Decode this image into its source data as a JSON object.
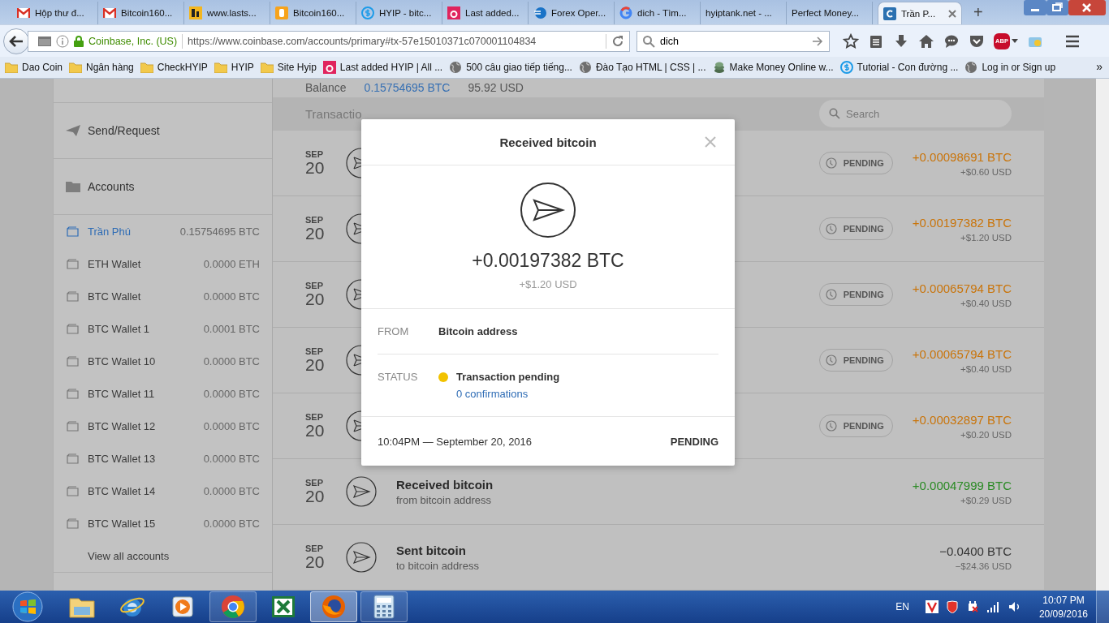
{
  "browser": {
    "tabs": [
      {
        "title": "Hộp thư đ...",
        "kind": "mail",
        "selected": false
      },
      {
        "title": "Bitcoin160...",
        "kind": "mail",
        "selected": false
      },
      {
        "title": "www.lasts...",
        "kind": "pi",
        "selected": false
      },
      {
        "title": "Bitcoin160...",
        "kind": "b",
        "selected": false
      },
      {
        "title": "HYIP - bitc...",
        "kind": "dollar",
        "selected": false
      },
      {
        "title": "Last added...",
        "kind": "a",
        "selected": false
      },
      {
        "title": "Forex Oper...",
        "kind": "forex",
        "selected": false
      },
      {
        "title": "dich - Tìm...",
        "kind": "g",
        "selected": false
      },
      {
        "title": "hyiptank.net - ...",
        "kind": "none",
        "selected": false
      },
      {
        "title": "Perfect Money...",
        "kind": "none",
        "selected": false
      },
      {
        "title": "Trần P...",
        "kind": "c",
        "selected": true
      }
    ],
    "new_tab": "+",
    "site_identity": "Coinbase, Inc. (US)",
    "url": "https://www.coinbase.com/accounts/primary#tx-57e15010371c070001104834",
    "search": {
      "value": "dich"
    },
    "abp_label": "ABP",
    "bookmarks": [
      {
        "label": "Dao Coin",
        "kind": "folder"
      },
      {
        "label": "Ngân hàng",
        "kind": "folder"
      },
      {
        "label": "CheckHYIP",
        "kind": "folder"
      },
      {
        "label": "HYIP",
        "kind": "folder"
      },
      {
        "label": "Site Hyip",
        "kind": "folder"
      },
      {
        "label": "Last added HYIP | All ...",
        "kind": "a"
      },
      {
        "label": "500 câu giao tiếp tiếng...",
        "kind": "globe"
      },
      {
        "label": "Đào Tạo HTML | CSS | ...",
        "kind": "globe"
      },
      {
        "label": "Make Money Online w...",
        "kind": "coin"
      },
      {
        "label": "Tutorial - Con đường ...",
        "kind": "dollar"
      },
      {
        "label": "Log in or Sign up",
        "kind": "globe"
      }
    ],
    "bookmarks_more": "»"
  },
  "sidebar": {
    "nav": [
      {
        "label": "Send/Request",
        "kind": "plane"
      },
      {
        "label": "Accounts",
        "kind": "folder"
      }
    ],
    "accounts": [
      {
        "name": "Trần Phú",
        "balance": "0.15754695 BTC",
        "selected": true
      },
      {
        "name": "ETH Wallet",
        "balance": "0.0000 ETH",
        "selected": false
      },
      {
        "name": "BTC Wallet",
        "balance": "0.0000 BTC",
        "selected": false
      },
      {
        "name": "BTC Wallet 1",
        "balance": "0.0001 BTC",
        "selected": false
      },
      {
        "name": "BTC Wallet 10",
        "balance": "0.0000 BTC",
        "selected": false
      },
      {
        "name": "BTC Wallet 11",
        "balance": "0.0000 BTC",
        "selected": false
      },
      {
        "name": "BTC Wallet 12",
        "balance": "0.0000 BTC",
        "selected": false
      },
      {
        "name": "BTC Wallet 13",
        "balance": "0.0000 BTC",
        "selected": false
      },
      {
        "name": "BTC Wallet 14",
        "balance": "0.0000 BTC",
        "selected": false
      },
      {
        "name": "BTC Wallet 15",
        "balance": "0.0000 BTC",
        "selected": false
      }
    ],
    "view_all": "View all accounts"
  },
  "balance": {
    "label": "Balance",
    "btc": "0.15754695 BTC",
    "usd": "95.92 USD"
  },
  "transactions": {
    "heading": "Transactio",
    "search": {
      "placeholder": "Search"
    },
    "rows": [
      {
        "kind": "pending",
        "month": "SEP",
        "day": "20",
        "status": "PENDING",
        "amount": "+0.00098691 BTC",
        "usd": "+$0.60 USD"
      },
      {
        "kind": "pending",
        "month": "SEP",
        "day": "20",
        "status": "PENDING",
        "amount": "+0.00197382 BTC",
        "usd": "+$1.20 USD"
      },
      {
        "kind": "pending",
        "month": "SEP",
        "day": "20",
        "status": "PENDING",
        "amount": "+0.00065794 BTC",
        "usd": "+$0.40 USD"
      },
      {
        "kind": "pending",
        "month": "SEP",
        "day": "20",
        "status": "PENDING",
        "amount": "+0.00065794 BTC",
        "usd": "+$0.40 USD"
      },
      {
        "kind": "pending",
        "month": "SEP",
        "day": "20",
        "status": "PENDING",
        "amount": "+0.00032897 BTC",
        "usd": "+$0.20 USD"
      },
      {
        "kind": "received",
        "month": "SEP",
        "day": "20",
        "title": "Received bitcoin",
        "subtitle": "from bitcoin address",
        "amount": "+0.00047999 BTC",
        "usd": "+$0.29 USD"
      },
      {
        "kind": "sent",
        "month": "SEP",
        "day": "20",
        "title": "Sent bitcoin",
        "subtitle": "to bitcoin address",
        "amount": "−0.0400 BTC",
        "usd": "−$24.36 USD"
      }
    ]
  },
  "modal": {
    "title": "Received bitcoin",
    "amount": "+0.00197382 BTC",
    "usd": "+$1.20 USD",
    "from": {
      "label": "FROM",
      "value": "Bitcoin address"
    },
    "status": {
      "label": "STATUS",
      "value": "Transaction pending",
      "detail": "0 confirmations",
      "pending": true
    },
    "time": "10:04PM — September 20, 2016",
    "footer_status": "PENDING"
  },
  "taskbar": {
    "apps": [
      {
        "kind": "explorer",
        "running": false,
        "selected": false
      },
      {
        "kind": "ie",
        "running": false,
        "selected": false
      },
      {
        "kind": "media",
        "running": false,
        "selected": false
      },
      {
        "kind": "chrome",
        "running": true,
        "selected": false
      },
      {
        "kind": "excel",
        "running": false,
        "selected": false
      },
      {
        "kind": "firefox",
        "running": true,
        "selected": true
      },
      {
        "kind": "calculator",
        "running": true,
        "selected": false
      }
    ],
    "language": "EN",
    "time": "10:07 PM",
    "date": "20/09/2016"
  }
}
